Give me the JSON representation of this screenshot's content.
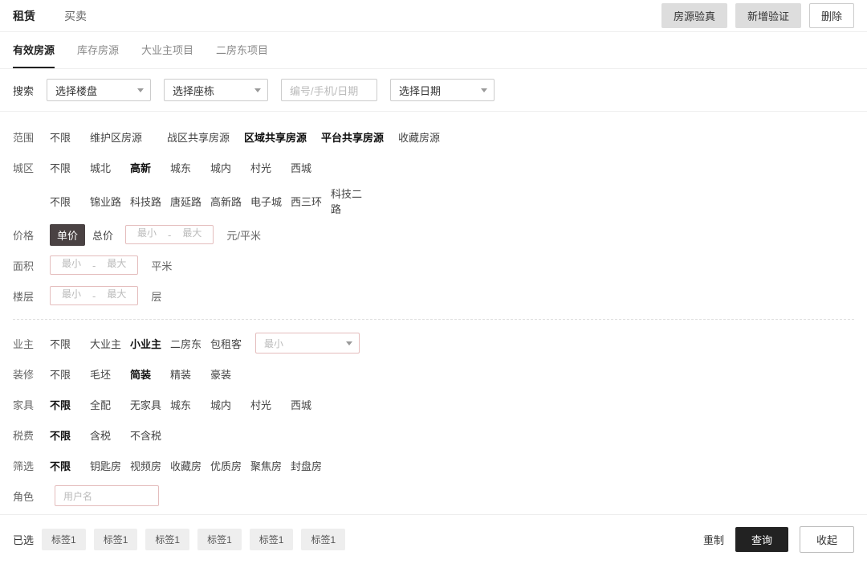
{
  "top": {
    "tabs": [
      "租赁",
      "买卖"
    ],
    "btns": [
      "房源验真",
      "新增验证",
      "删除"
    ]
  },
  "sub": {
    "tabs": [
      "有效房源",
      "库存房源",
      "大业主项目",
      "二房东项目"
    ]
  },
  "search": {
    "label": "搜索",
    "sel1": "选择楼盘",
    "sel2": "选择座栋",
    "txt": "编号/手机/日期",
    "sel3": "选择日期"
  },
  "filters": {
    "scope": {
      "label": "范围",
      "opts": [
        "不限",
        "维护区房源",
        "战区共享房源",
        "区域共享房源",
        "平台共享房源",
        "收藏房源"
      ]
    },
    "area": {
      "label": "城区",
      "opts": [
        "不限",
        "城北",
        "高新",
        "城东",
        "城内",
        "村光",
        "西城"
      ]
    },
    "road": {
      "opts": [
        "不限",
        "锦业路",
        "科技路",
        "唐延路",
        "高新路",
        "电子城",
        "西三环",
        "科技二路"
      ]
    },
    "price": {
      "label": "价格",
      "opts": [
        "单价",
        "总价"
      ],
      "min": "最小",
      "max": "最大",
      "unit": "元/平米"
    },
    "size": {
      "label": "面积",
      "min": "最小",
      "max": "最大",
      "unit": "平米"
    },
    "floor": {
      "label": "楼层",
      "min": "最小",
      "max": "最大",
      "unit": "层"
    },
    "owner": {
      "label": "业主",
      "opts": [
        "不限",
        "大业主",
        "小业主",
        "二房东",
        "包租客"
      ],
      "selph": "最小"
    },
    "deco": {
      "label": "装修",
      "opts": [
        "不限",
        "毛坯",
        "简装",
        "精装",
        "豪装"
      ]
    },
    "furn": {
      "label": "家具",
      "opts": [
        "不限",
        "全配",
        "无家具",
        "城东",
        "城内",
        "村光",
        "西城"
      ]
    },
    "tax": {
      "label": "税费",
      "opts": [
        "不限",
        "含税",
        "不含税"
      ]
    },
    "screen": {
      "label": "筛选",
      "opts": [
        "不限",
        "钥匙房",
        "视频房",
        "收藏房",
        "优质房",
        "聚焦房",
        "封盘房"
      ]
    },
    "role": {
      "label": "角色",
      "ph": "用户名"
    }
  },
  "bottom": {
    "label": "已选",
    "tags": [
      "标签1",
      "标签1",
      "标签1",
      "标签1",
      "标签1",
      "标签1"
    ],
    "reset": "重制",
    "query": "查询",
    "collapse": "收起"
  }
}
